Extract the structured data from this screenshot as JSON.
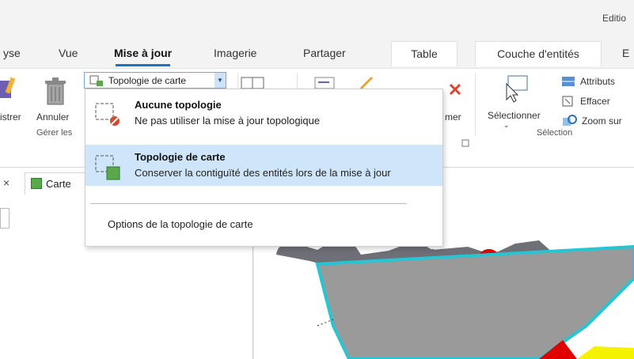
{
  "window": {
    "title": "Editio"
  },
  "tabs": [
    {
      "label": "yse"
    },
    {
      "label": "Vue"
    },
    {
      "label": "Mise à jour"
    },
    {
      "label": "Imagerie"
    },
    {
      "label": "Partager"
    },
    {
      "label": "Table"
    },
    {
      "label": "Couche d'entités"
    },
    {
      "label": "E"
    }
  ],
  "ribbon": {
    "enregistrer_label": "istrer",
    "annuler_label": "Annuler",
    "supprimer_label": "mer",
    "selectionner_label": "Sélectionner",
    "attributs_label": "Attributs",
    "effacer_label": "Effacer",
    "zoom_label": "Zoom sur",
    "topology_combo": {
      "value": "Topologie de carte"
    },
    "groups": {
      "gerer": "Gérer les",
      "selection": "Sélection"
    }
  },
  "dropdown": {
    "items": [
      {
        "title": "Aucune topologie",
        "description": "Ne pas utiliser la mise à jour topologique",
        "selected": false
      },
      {
        "title": "Topologie de carte",
        "description": "Conserver la contiguïté des entités lors de la mise à jour",
        "selected": true
      }
    ],
    "options_label": "Options de la topologie de carte"
  },
  "pane": {
    "map_tab": "Carte"
  },
  "colors": {
    "accent": "#1a73c8",
    "selected_bg": "#cfe6fa",
    "map_gray": "#9a9a9a",
    "map_outline": "#27c5d1",
    "map_red": "#e00000",
    "map_yellow": "#f5f200"
  }
}
